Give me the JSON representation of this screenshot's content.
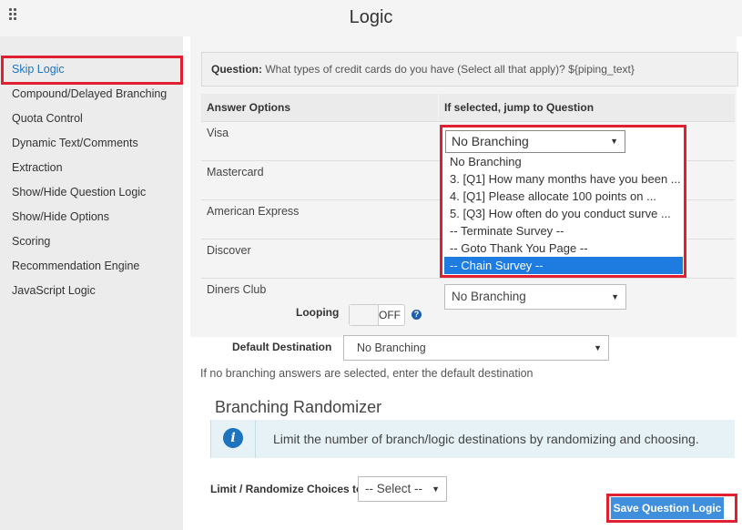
{
  "header": {
    "title": "Logic"
  },
  "sidebar": {
    "items": [
      {
        "label": "Skip Logic",
        "active": true
      },
      {
        "label": "Compound/Delayed Branching"
      },
      {
        "label": "Quota Control"
      },
      {
        "label": "Dynamic Text/Comments"
      },
      {
        "label": "Extraction"
      },
      {
        "label": "Show/Hide Question Logic"
      },
      {
        "label": "Show/Hide Options"
      },
      {
        "label": "Scoring"
      },
      {
        "label": "Recommendation Engine"
      },
      {
        "label": "JavaScript Logic"
      }
    ]
  },
  "question": {
    "prefix": "Question:",
    "text": " What types of credit cards do you have (Select all that apply)? ${piping_text}"
  },
  "table": {
    "headers": [
      "Answer Options",
      "If selected, jump to Question"
    ],
    "answers": [
      "Visa",
      "Mastercard",
      "American Express",
      "Discover",
      "Diners Club"
    ]
  },
  "dropdown_open": {
    "value": "No Branching",
    "options": [
      "No Branching",
      "3. [Q1] How many months have you been ...",
      "4. [Q1] Please allocate 100 points on ...",
      "5. [Q3] How often do you conduct surve ...",
      "-- Terminate Survey --",
      "-- Goto Thank You Page --",
      "-- Chain Survey --"
    ],
    "highlighted": "-- Chain Survey --"
  },
  "diners_select": {
    "value": "No Branching"
  },
  "looping": {
    "label": "Looping",
    "state": "OFF"
  },
  "default_destination": {
    "label": "Default Destination",
    "value": "No Branching"
  },
  "hint": "If no branching answers are selected, enter the default destination",
  "randomizer": {
    "title": "Branching Randomizer",
    "info": "Limit the number of branch/logic destinations by randomizing and choosing.",
    "limit_label": "Limit / Randomize Choices to",
    "limit_value": "-- Select --"
  },
  "save_label": "Save Question Logic",
  "colors": {
    "accent": "#1e73be",
    "highlight_outline": "#e02030",
    "button": "#3f8fdc"
  }
}
